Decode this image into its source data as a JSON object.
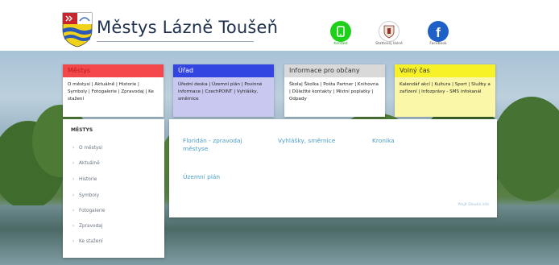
{
  "header": {
    "site_title": "Městys Lázně Toušeň"
  },
  "quick_links": [
    {
      "label": "Kontakt",
      "icon": "phone-icon",
      "color": "#1fd01a"
    },
    {
      "label": "Stattovej lázně",
      "icon": "crest-icon",
      "color": "#ffffff"
    },
    {
      "label": "Facebook",
      "icon": "facebook-icon",
      "color": "#1f5fc8"
    }
  ],
  "categories": [
    {
      "title": "Městys",
      "color": "#f2474b",
      "title_color": "#c01b1b",
      "links": "O městysi | Aktuálně | Historie | Symboly | Fotogalerie | Zpravodaj | Ke stažení"
    },
    {
      "title": "Úřad",
      "color": "#3345e0",
      "title_color": "#ffffff",
      "links": "Úřední deska | Územní plán | Povinné informace | CzechPOINT | Vyhlášky, směrnice"
    },
    {
      "title": "Informace pro občany",
      "color": "#d9d9d9",
      "title_color": "#333333",
      "links": "Škola| Školka | Pošta Partner | Knihovna | Důležité kontakty | Místní poplatky | Odpady"
    },
    {
      "title": "Volný čas",
      "color": "#f7f128",
      "title_color": "#333333",
      "links": "Kalendář akcí | Kultura | Sport | Služby a zařízení | Infozprávy - SMS infokanál"
    }
  ],
  "sidebar": {
    "title": "MĚSTYS",
    "items": [
      "O městysi",
      "Aktuálně",
      "Historie",
      "Symboly",
      "Fotogalerie",
      "Zpravodaj",
      "Ke stažení"
    ]
  },
  "main": {
    "links": [
      "Floridán - zpravodaj městyse",
      "Vyhlášky, směrnice",
      "Kronika",
      "Územní plán"
    ],
    "more_label": "Přejít Dlouhá info"
  }
}
